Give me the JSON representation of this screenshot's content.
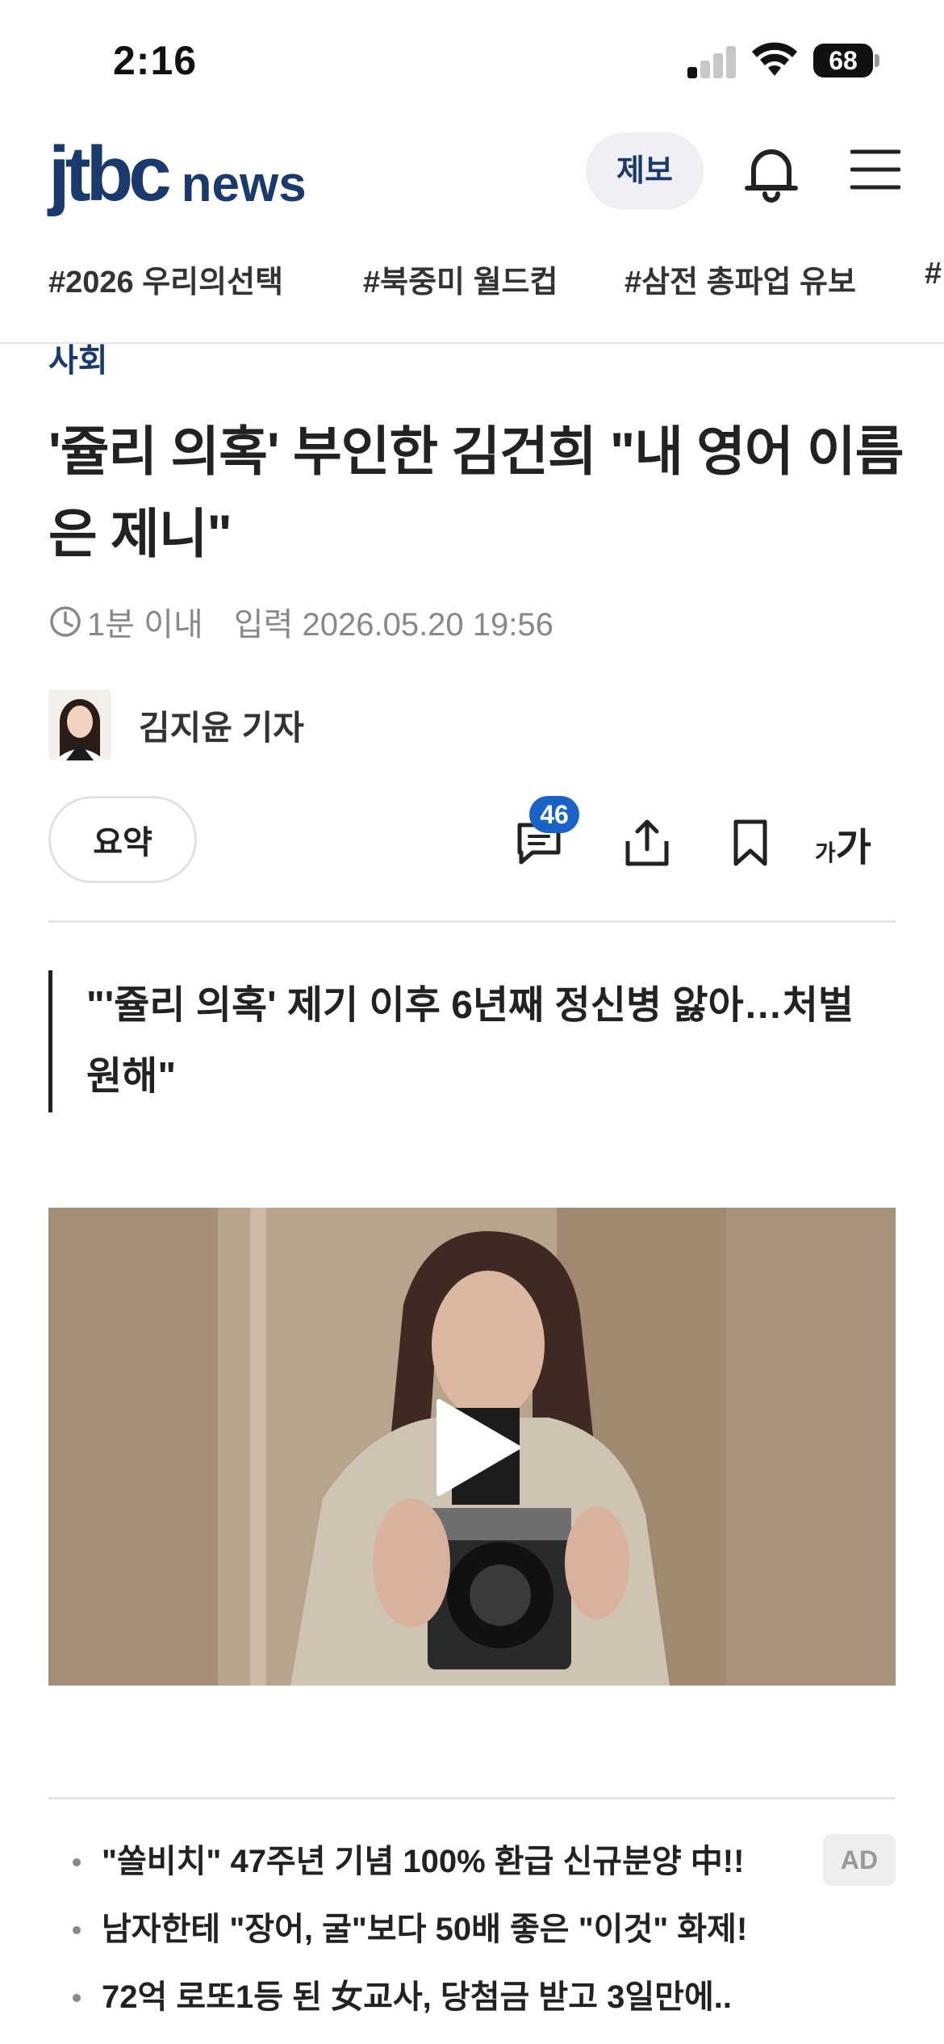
{
  "status_bar": {
    "time": "2:16",
    "battery": "68",
    "signal_bars_active": 1,
    "signal_bars_total": 4
  },
  "header": {
    "logo_brand": "jtbc",
    "logo_suffix": "news",
    "tip_button": "제보",
    "icons": [
      "bell-icon",
      "hamburger-menu-icon"
    ],
    "brand_color": "#1a3a6e"
  },
  "hashtags": [
    "#2026 우리의선택",
    "#북중미 월드컵",
    "#삼전 총파업 유보",
    "#"
  ],
  "article": {
    "section": "사회",
    "headline": "'쥴리 의혹' 부인한 김건희 \"내 영어 이름은 제니\"",
    "read_time": "1분 이내",
    "published": "입력 2026.05.20 19:56",
    "reporter": "김지윤 기자",
    "summary_button": "요약",
    "comment_count": "46",
    "font_size_small": "가",
    "font_size_big": "가",
    "quote": "\"'쥴리 의혹' 제기 이후 6년째 정신병 앓아…처벌 원해\""
  },
  "ads": {
    "badge": "AD",
    "items": [
      "\"쏠비치\" 47주년 기념 100% 환급 신규분양 中!!",
      "남자한테 \"장어, 굴\"보다 50배 좋은 \"이것\" 화제!",
      "72억 로또1등 된 女교사, 당첨금 받고 3일만에.."
    ]
  },
  "colors": {
    "accent": "#1a3a6e",
    "badge_blue": "#1a63c6",
    "muted_text": "#888888"
  }
}
